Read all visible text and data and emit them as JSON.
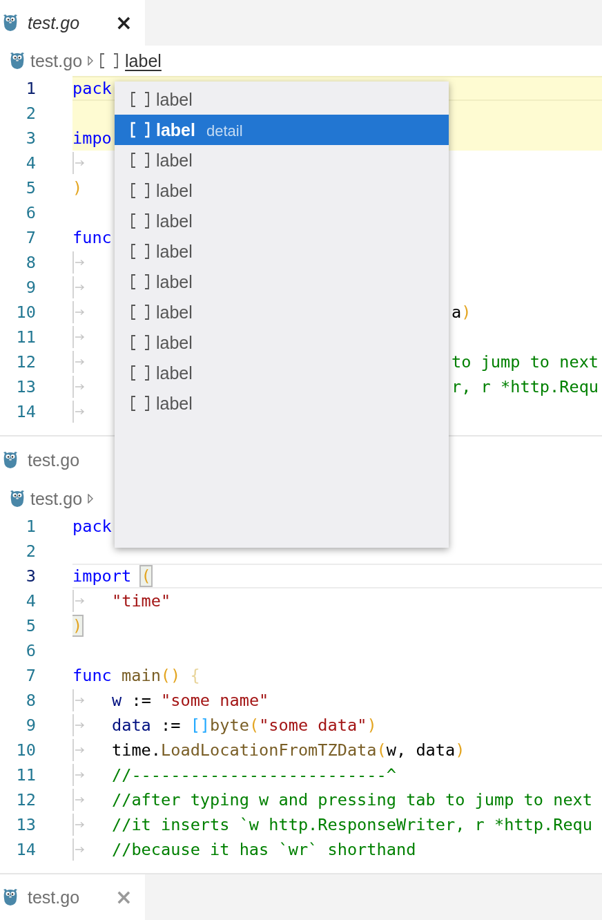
{
  "editors": [
    {
      "tab": {
        "label": "test.go",
        "preview": true,
        "active": true,
        "close": "×"
      },
      "tab_bar_fill": false,
      "breadcrumb": {
        "trailing_separator": false,
        "items": [
          {
            "kind": "file",
            "label": "test.go",
            "focused": false
          },
          {
            "kind": "symbol",
            "label": "label",
            "focused": true
          }
        ]
      },
      "lines": [
        {
          "number": "1",
          "current": true,
          "highlighted": true,
          "indented": false,
          "left": [
            {
              "kind": "keyword",
              "text": "pack"
            }
          ]
        },
        {
          "number": "2",
          "current": false,
          "highlighted": true,
          "indented": false
        },
        {
          "number": "3",
          "current": false,
          "highlighted": true,
          "indented": false,
          "left": [
            {
              "kind": "keyword",
              "text": "impo"
            }
          ]
        },
        {
          "number": "4",
          "current": false,
          "highlighted": false,
          "indented": true
        },
        {
          "number": "5",
          "current": false,
          "highlighted": false,
          "indented": false,
          "left": [
            {
              "kind": "paren",
              "text": ")",
              "matched": false
            }
          ]
        },
        {
          "number": "6",
          "current": false,
          "highlighted": false,
          "indented": false
        },
        {
          "number": "7",
          "current": false,
          "highlighted": false,
          "indented": false,
          "left": [
            {
              "kind": "keyword",
              "text": "func"
            }
          ]
        },
        {
          "number": "8",
          "current": false,
          "highlighted": false,
          "indented": true
        },
        {
          "number": "9",
          "current": false,
          "highlighted": false,
          "indented": true
        },
        {
          "number": "10",
          "current": false,
          "highlighted": false,
          "indented": true,
          "right": [
            {
              "kind": "plain",
              "text": "a"
            },
            {
              "kind": "paren",
              "text": ")",
              "matched": false
            }
          ]
        },
        {
          "number": "11",
          "current": false,
          "highlighted": false,
          "indented": true
        },
        {
          "number": "12",
          "current": false,
          "highlighted": false,
          "indented": true,
          "right": [
            {
              "kind": "comment",
              "text": "to jump to next"
            }
          ]
        },
        {
          "number": "13",
          "current": false,
          "highlighted": false,
          "indented": true,
          "right": [
            {
              "kind": "comment",
              "text": "r, r *http.Requ"
            }
          ]
        },
        {
          "number": "14",
          "current": false,
          "highlighted": false,
          "indented": true
        }
      ]
    },
    {
      "tab": {
        "label": "test.go",
        "preview": false,
        "active": false
      },
      "tab_bar_fill": true,
      "breadcrumb": {
        "trailing_separator": true,
        "items": [
          {
            "kind": "file",
            "label": "test.go",
            "focused": false
          }
        ]
      },
      "lines": [
        {
          "number": "1",
          "current": false,
          "highlighted": false,
          "indented": false,
          "left": [
            {
              "kind": "keyword",
              "text": "pack"
            }
          ]
        },
        {
          "number": "2",
          "current": false,
          "highlighted": false,
          "indented": false
        },
        {
          "number": "3",
          "current": true,
          "highlighted": false,
          "indented": false,
          "left": [
            {
              "kind": "keyword",
              "text": "import "
            },
            {
              "kind": "paren",
              "text": "(",
              "matched": true
            }
          ]
        },
        {
          "number": "4",
          "current": false,
          "highlighted": false,
          "indented": true,
          "left": [
            {
              "kind": "string",
              "text": "\"time\""
            }
          ]
        },
        {
          "number": "5",
          "current": false,
          "highlighted": false,
          "indented": false,
          "left": [
            {
              "kind": "paren",
              "text": ")",
              "matched": true
            }
          ]
        },
        {
          "number": "6",
          "current": false,
          "highlighted": false,
          "indented": false
        },
        {
          "number": "7",
          "current": false,
          "highlighted": false,
          "indented": false,
          "left": [
            {
              "kind": "keyword",
              "text": "func "
            },
            {
              "kind": "function",
              "text": "main"
            },
            {
              "kind": "paren",
              "text": "()",
              "matched": false
            },
            {
              "kind": "brace",
              "text": " {"
            }
          ]
        },
        {
          "number": "8",
          "current": false,
          "highlighted": false,
          "indented": true,
          "left": [
            {
              "kind": "variable",
              "text": "w"
            },
            {
              "kind": "plain",
              "text": " := "
            },
            {
              "kind": "string",
              "text": "\"some name\""
            }
          ]
        },
        {
          "number": "9",
          "current": false,
          "highlighted": false,
          "indented": true,
          "left": [
            {
              "kind": "variable",
              "text": "data"
            },
            {
              "kind": "plain",
              "text": " := "
            },
            {
              "kind": "bracket",
              "text": "[]"
            },
            {
              "kind": "function",
              "text": "byte"
            },
            {
              "kind": "paren",
              "text": "(",
              "matched": false
            },
            {
              "kind": "string",
              "text": "\"some data\""
            },
            {
              "kind": "paren",
              "text": ")",
              "matched": false
            }
          ]
        },
        {
          "number": "10",
          "current": false,
          "highlighted": false,
          "indented": true,
          "left": [
            {
              "kind": "plain",
              "text": "time."
            },
            {
              "kind": "function",
              "text": "LoadLocationFromTZData"
            },
            {
              "kind": "paren",
              "text": "(",
              "matched": false
            },
            {
              "kind": "plain",
              "text": "w, data"
            },
            {
              "kind": "paren",
              "text": ")",
              "matched": false
            }
          ]
        },
        {
          "number": "11",
          "current": false,
          "highlighted": false,
          "indented": true,
          "left": [
            {
              "kind": "comment",
              "text": "//--------------------------^"
            }
          ]
        },
        {
          "number": "12",
          "current": false,
          "highlighted": false,
          "indented": true,
          "left": [
            {
              "kind": "comment",
              "text": "//after typing w and pressing tab to jump to next"
            }
          ]
        },
        {
          "number": "13",
          "current": false,
          "highlighted": false,
          "indented": true,
          "left": [
            {
              "kind": "comment",
              "text": "//it inserts `w http.ResponseWriter, r *http.Requ"
            }
          ]
        },
        {
          "number": "14",
          "current": false,
          "highlighted": false,
          "indented": true,
          "left": [
            {
              "kind": "comment",
              "text": "//because it has `wr` shorthand"
            }
          ]
        }
      ]
    },
    {
      "tab": {
        "label": "test.go",
        "preview": false,
        "active": false,
        "close": "×"
      },
      "tab_bar_fill": false
    }
  ],
  "suggestions": [
    {
      "label": "label",
      "selected": false
    },
    {
      "label": "label",
      "selected": true,
      "detail": "detail"
    },
    {
      "label": "label",
      "selected": false
    },
    {
      "label": "label",
      "selected": false
    },
    {
      "label": "label",
      "selected": false
    },
    {
      "label": "label",
      "selected": false
    },
    {
      "label": "label",
      "selected": false
    },
    {
      "label": "label",
      "selected": false
    },
    {
      "label": "label",
      "selected": false
    },
    {
      "label": "label",
      "selected": false
    },
    {
      "label": "label",
      "selected": false
    }
  ]
}
